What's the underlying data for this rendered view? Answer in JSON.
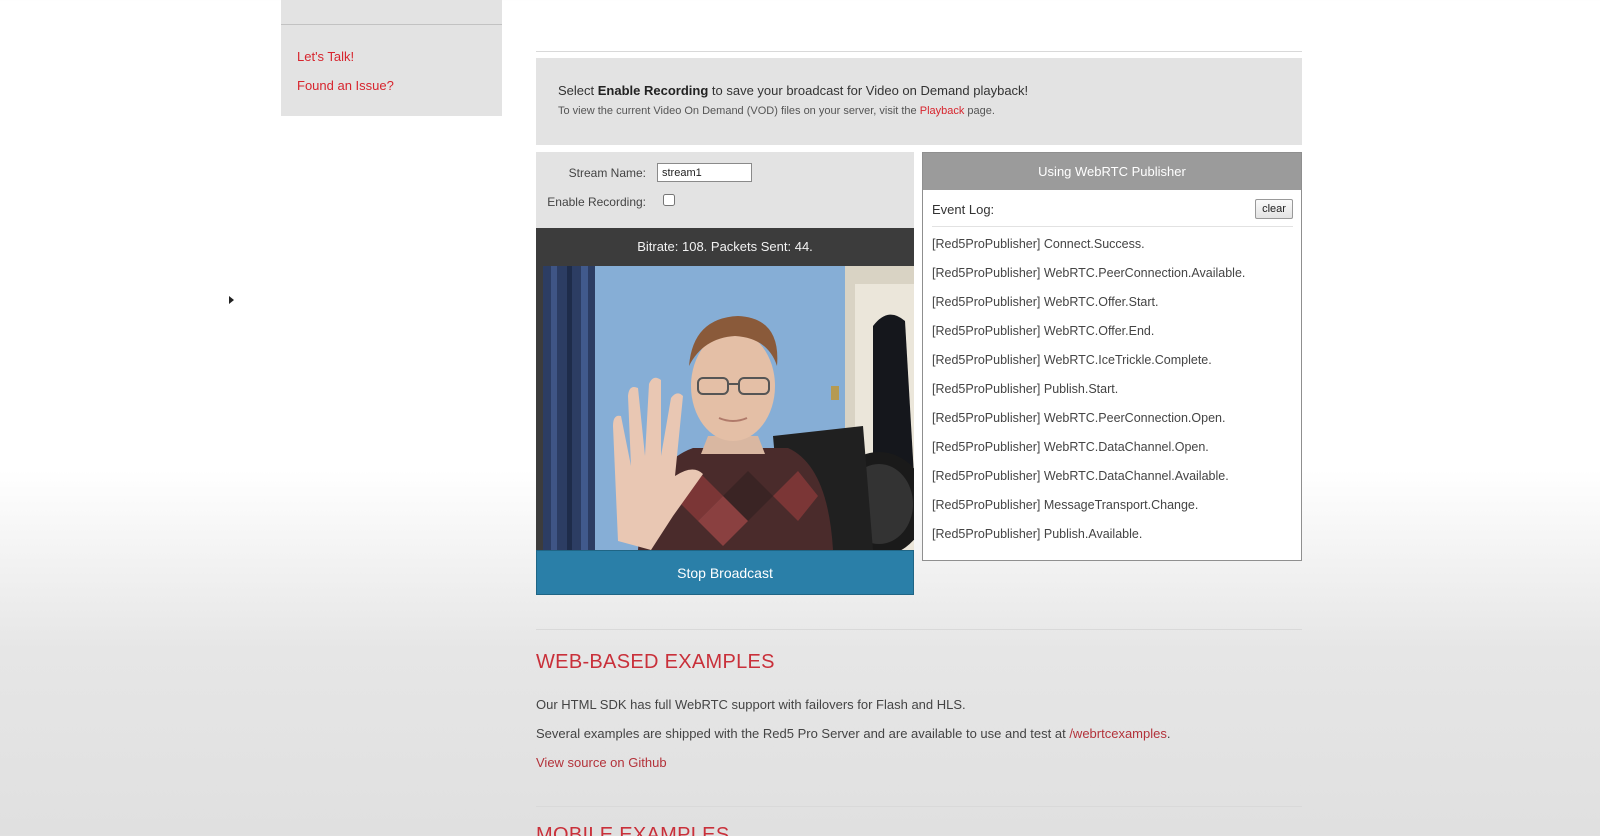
{
  "sidebar": {
    "links": [
      "Let's Talk!",
      "Found an Issue?"
    ]
  },
  "info": {
    "line1_pre": "Select ",
    "line1_bold": "Enable Recording",
    "line1_post": " to save your broadcast for Video on Demand playback!",
    "line2_pre": "To view the current Video On Demand (VOD) files on your server, visit the ",
    "line2_link": "Playback",
    "line2_post": " page."
  },
  "form": {
    "stream_name_label": "Stream Name:",
    "stream_name_value": "stream1",
    "enable_recording_label": "Enable Recording:",
    "enable_recording_checked": false
  },
  "video": {
    "status": "Bitrate: 108. Packets Sent: 44.",
    "stop_label": "Stop Broadcast",
    "accent": "#2a7fa8"
  },
  "publisher": {
    "title": "Using WebRTC Publisher",
    "event_log_label": "Event Log:",
    "clear_label": "clear",
    "events": [
      "[Red5ProPublisher] Connect.Success.",
      "[Red5ProPublisher] WebRTC.PeerConnection.Available.",
      "[Red5ProPublisher] WebRTC.Offer.Start.",
      "[Red5ProPublisher] WebRTC.Offer.End.",
      "[Red5ProPublisher] WebRTC.IceTrickle.Complete.",
      "[Red5ProPublisher] Publish.Start.",
      "[Red5ProPublisher] WebRTC.PeerConnection.Open.",
      "[Red5ProPublisher] WebRTC.DataChannel.Open.",
      "[Red5ProPublisher] WebRTC.DataChannel.Available.",
      "[Red5ProPublisher] MessageTransport.Change.",
      "[Red5ProPublisher] Publish.Available."
    ]
  },
  "web_examples": {
    "title": "WEB-BASED EXAMPLES",
    "para1": "Our HTML SDK has full WebRTC support with failovers for Flash and HLS.",
    "para2_pre": "Several examples are shipped with the Red5 Pro Server and are available to use and test at ",
    "para2_link": "/webrtcexamples",
    "para2_post": ".",
    "github_link": "View source on Github"
  },
  "mobile_examples": {
    "title": "MOBILE EXAMPLES"
  },
  "colors": {
    "brand_red": "#d7252e",
    "panel_gray": "#e3e3e3"
  }
}
